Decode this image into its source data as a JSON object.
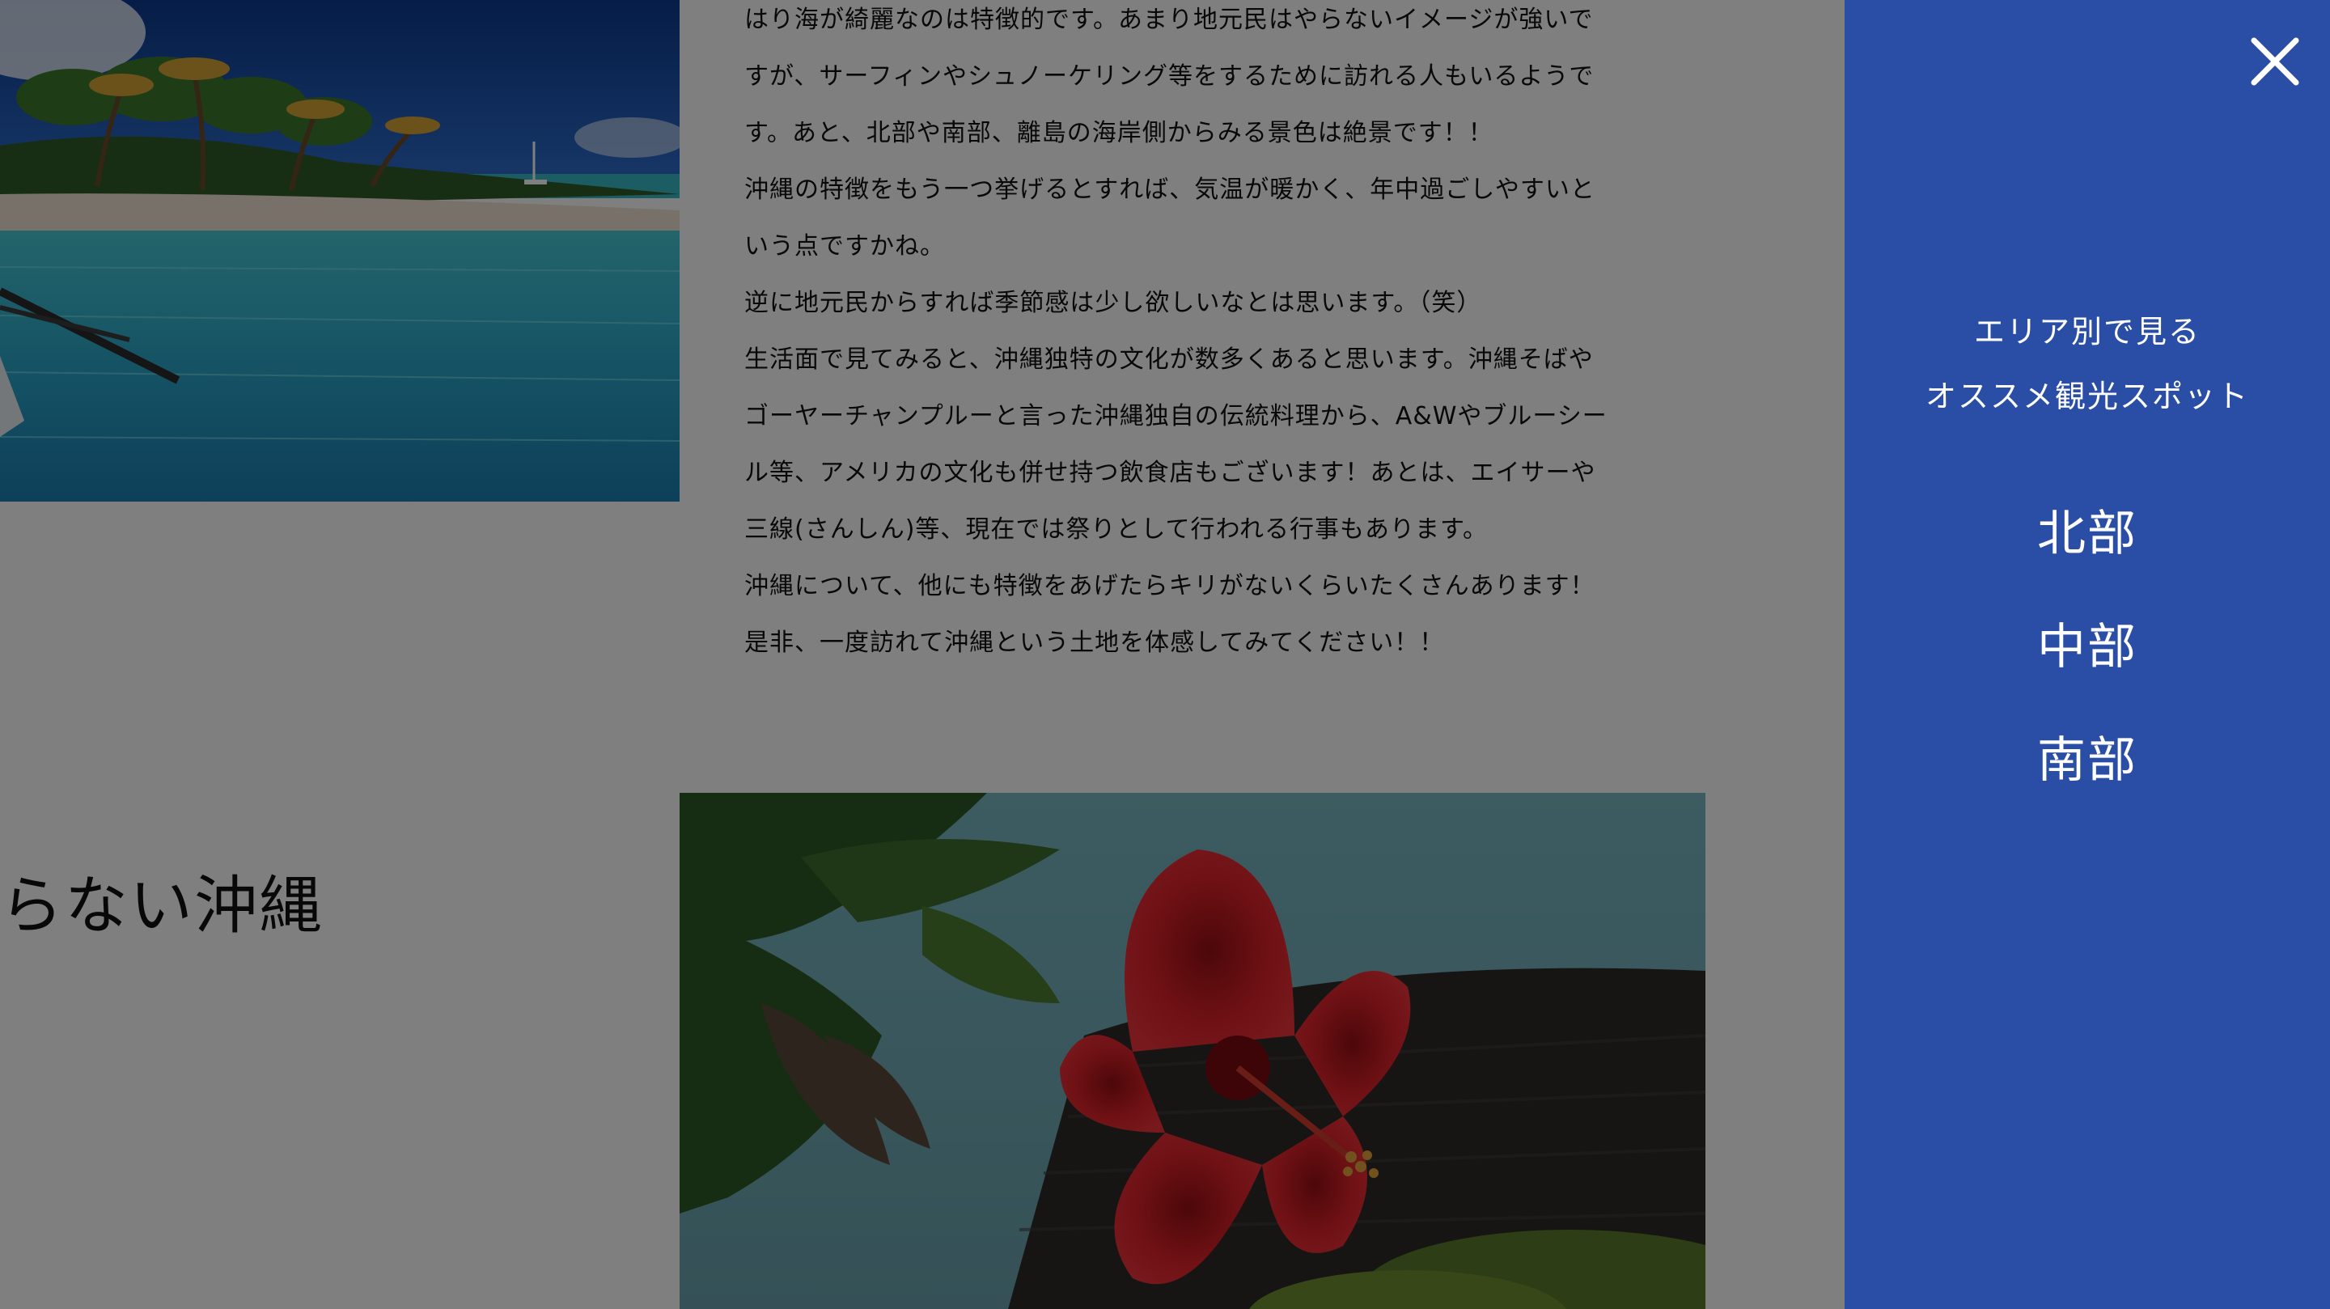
{
  "article": {
    "lines": [
      "はり海が綺麗なのは特徴的です。あまり地元民はやらないイメージが強いで",
      "すが、サーフィンやシュノーケリング等をするために訪れる人もいるようで",
      "す。あと、北部や南部、離島の海岸側からみる景色は絶景です！！",
      "沖縄の特徴をもう一つ挙げるとすれば、気温が暖かく、年中過ごしやすいと",
      "いう点ですかね。",
      "逆に地元民からすれば季節感は少し欲しいなとは思います。（笑）",
      "生活面で見てみると、沖縄独特の文化が数多くあると思います。沖縄そばや",
      "ゴーヤーチャンプルーと言った沖縄独自の伝統料理から、A&Wやブルーシー",
      "ル等、アメリカの文化も併せ持つ飲食店もございます！あとは、エイサーや",
      "三線(さんしん)等、現在では祭りとして行われる行事もあります。",
      "沖縄について、他にも特徴をあげたらキリがないくらいたくさんあります！",
      "是非、一度訪れて沖縄という土地を体感してみてください！！"
    ]
  },
  "section": {
    "title": "知らない沖縄"
  },
  "drawer": {
    "close_icon": "close-icon",
    "heading_line1": "エリア別で見る",
    "heading_line2": "オススメ観光スポット",
    "areas": [
      "北部",
      "中部",
      "南部"
    ],
    "background_color": "#2a4ea6"
  },
  "overlay_color": "rgba(0,0,0,0.5)"
}
